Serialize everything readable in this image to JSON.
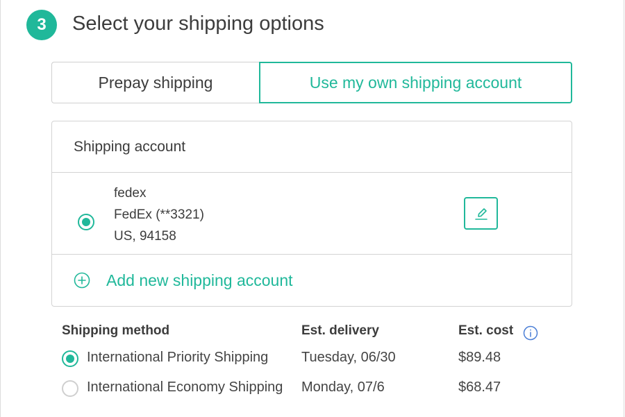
{
  "step": {
    "number": "3",
    "title": "Select your shipping options"
  },
  "tabs": [
    {
      "label": "Prepay shipping",
      "selected": false
    },
    {
      "label": "Use my own shipping account",
      "selected": true
    }
  ],
  "shipping_account": {
    "header": "Shipping account",
    "account": {
      "name": "fedex",
      "carrier": "FedEx (**3321)",
      "location": "US, 94158",
      "selected": true
    },
    "edit_icon": "pencil-icon",
    "add_label": "Add new shipping account",
    "add_icon": "plus-circle-icon"
  },
  "methods": {
    "headers": {
      "method": "Shipping method",
      "delivery": "Est. delivery",
      "cost": "Est. cost"
    },
    "info_icon": "info-icon",
    "rows": [
      {
        "name": "International Priority Shipping",
        "delivery": "Tuesday, 06/30",
        "cost": "$89.48",
        "selected": true
      },
      {
        "name": "International Economy Shipping",
        "delivery": "Monday, 07/6",
        "cost": "$68.47",
        "selected": false
      }
    ]
  },
  "colors": {
    "accent": "#20b89a",
    "border": "#d3d3d3",
    "text": "#3c3c3c"
  }
}
